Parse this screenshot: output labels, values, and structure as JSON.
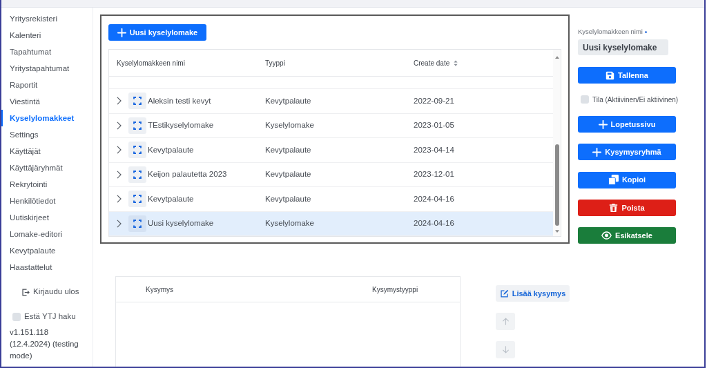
{
  "sidebar": {
    "items": [
      {
        "label": "Yritysrekisteri",
        "selected": false
      },
      {
        "label": "Kalenteri",
        "selected": false
      },
      {
        "label": "Tapahtumat",
        "selected": false
      },
      {
        "label": "Yritystapahtumat",
        "selected": false
      },
      {
        "label": "Raportit",
        "selected": false
      },
      {
        "label": "Viestintä",
        "selected": false
      },
      {
        "label": "Kyselylomakkeet",
        "selected": true
      },
      {
        "label": "Settings",
        "selected": false
      },
      {
        "label": "Käyttäjät",
        "selected": false
      },
      {
        "label": "Käyttäjäryhmät",
        "selected": false
      },
      {
        "label": "Rekrytointi",
        "selected": false
      },
      {
        "label": "Henkilötiedot",
        "selected": false
      },
      {
        "label": "Uutiskirjeet",
        "selected": false
      },
      {
        "label": "Lomake-editori",
        "selected": false
      },
      {
        "label": "Kevytpalaute",
        "selected": false
      },
      {
        "label": "Haastattelut",
        "selected": false
      }
    ],
    "logout": {
      "label": "Kirjaudu ulos"
    },
    "ytj_block": {
      "label": "Estä YTJ haku",
      "checked": false
    },
    "version": "v1.151.118 (12.4.2024) (testing mode)"
  },
  "forms": {
    "new_button": {
      "label": "Uusi kyselylomake"
    },
    "table": {
      "columns": [
        {
          "label": "Kyselylomakkeen nimi"
        },
        {
          "label": "Tyyppi"
        },
        {
          "label": "Create date",
          "sortable": true
        }
      ],
      "rows": [
        {
          "name": "Aleksin testi kevyt",
          "type": "Kevytpalaute",
          "date": "2022-09-21",
          "expanded": false,
          "selected": false
        },
        {
          "name": "TEstikyselylomake",
          "type": "Kyselylomake",
          "date": "2023-01-05",
          "expanded": false,
          "selected": false
        },
        {
          "name": "Kevytpalaute",
          "type": "Kevytpalaute",
          "date": "2023-04-14",
          "expanded": false,
          "selected": false
        },
        {
          "name": "Keijon palautetta 2023",
          "type": "Kevytpalaute",
          "date": "2023-12-01",
          "expanded": false,
          "selected": false
        },
        {
          "name": "Kevytpalaute",
          "type": "Kevytpalaute",
          "date": "2024-04-16",
          "expanded": false,
          "selected": false
        },
        {
          "name": "Uusi kyselylomake",
          "type": "Kyselylomake",
          "date": "2024-04-16",
          "expanded": false,
          "selected": true
        }
      ]
    }
  },
  "editor": {
    "name_field": {
      "label": "Kyselylomakkeen nimi",
      "required": true,
      "value": "Uusi kyselylomake"
    },
    "controls": [
      {
        "kind": "save",
        "label": "Tallenna"
      },
      {
        "kind": "checkbox",
        "label": "Tila (Aktiivinen/Ei aktiivinen)",
        "checked": false
      },
      {
        "kind": "add",
        "label": "Lopetussivu"
      },
      {
        "kind": "add",
        "label": "Kysymysryhmä"
      },
      {
        "kind": "copy",
        "label": "Kopioi"
      },
      {
        "kind": "delete",
        "label": "Poista"
      },
      {
        "kind": "preview",
        "label": "Esikatsele"
      }
    ]
  },
  "questions": {
    "table": {
      "columns": [
        {
          "label": "Kysymys"
        },
        {
          "label": "Kysymystyyppi"
        }
      ]
    },
    "add_button": {
      "label": "Lisää kysymys"
    },
    "move_buttons": [
      {
        "kind": "up",
        "disabled": true
      },
      {
        "kind": "down",
        "disabled": true
      }
    ]
  }
}
